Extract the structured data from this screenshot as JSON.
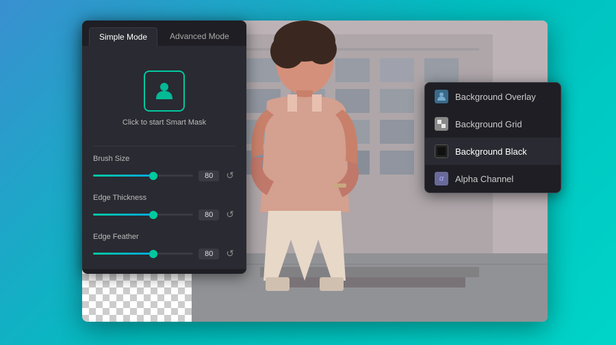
{
  "background": {
    "gradient_start": "#4a90d9",
    "gradient_end": "#00c9c8"
  },
  "panel": {
    "tabs": [
      {
        "id": "simple",
        "label": "Simple Mode",
        "active": true
      },
      {
        "id": "advanced",
        "label": "Advanced Mode",
        "active": false
      }
    ],
    "smart_mask_label": "Click to start Smart Mask",
    "sliders": [
      {
        "name": "Brush Size",
        "value": "80",
        "fill_percent": 60
      },
      {
        "name": "Edge Thickness",
        "value": "80",
        "fill_percent": 60
      },
      {
        "name": "Edge Feather",
        "value": "80",
        "fill_percent": 60
      }
    ]
  },
  "dropdown": {
    "items": [
      {
        "id": "overlay",
        "label": "Background Overlay",
        "icon_type": "overlay",
        "icon_char": "👤",
        "selected": false
      },
      {
        "id": "grid",
        "label": "Background Grid",
        "icon_type": "grid",
        "icon_char": "▦",
        "selected": false
      },
      {
        "id": "black",
        "label": "Background Black",
        "icon_type": "black",
        "icon_char": "■",
        "selected": true
      },
      {
        "id": "alpha",
        "label": "Alpha Channel",
        "icon_type": "alpha",
        "icon_char": "α",
        "selected": false
      }
    ]
  },
  "icons": {
    "smart_mask": "👤",
    "reset": "↺"
  }
}
